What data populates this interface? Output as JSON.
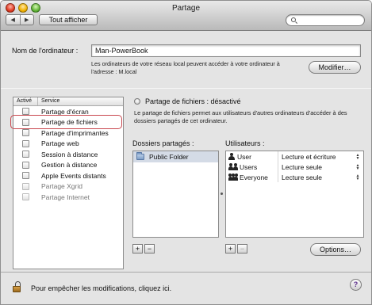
{
  "window": {
    "title": "Partage"
  },
  "toolbar": {
    "back": "◀",
    "forward": "▶",
    "show_all": "Tout afficher",
    "search_value": ""
  },
  "computer": {
    "label": "Nom de l'ordinateur :",
    "value": "Man-PowerBook",
    "note": "Les ordinateurs de votre réseau local peuvent accéder à votre ordinateur à l'adresse : M.local",
    "modify_button": "Modifier…"
  },
  "services": {
    "header_on": "Activé",
    "header_service": "Service",
    "items": [
      {
        "label": "Partage d'écran",
        "checked": false,
        "dim": false
      },
      {
        "label": "Partage de fichiers",
        "checked": false,
        "dim": false
      },
      {
        "label": "Partage d'imprimantes",
        "checked": false,
        "dim": false
      },
      {
        "label": "Partage web",
        "checked": false,
        "dim": false
      },
      {
        "label": "Session à distance",
        "checked": false,
        "dim": false
      },
      {
        "label": "Gestion à distance",
        "checked": false,
        "dim": false
      },
      {
        "label": "Apple Events distants",
        "checked": false,
        "dim": false
      },
      {
        "label": "Partage Xgrid",
        "checked": false,
        "dim": true
      },
      {
        "label": "Partage Internet",
        "checked": false,
        "dim": true
      }
    ]
  },
  "status": {
    "title": "Partage de fichiers : désactivé",
    "description": "Le partage de fichiers permet aux utilisateurs d'autres ordinateurs d'accéder à des dossiers partagés de cet ordinateur."
  },
  "folders": {
    "label": "Dossiers partagés :",
    "items": [
      "Public Folder"
    ]
  },
  "users": {
    "label": "Utilisateurs :",
    "items": [
      {
        "name": "User",
        "icon": "single-user-icon",
        "permission": "Lecture et écriture"
      },
      {
        "name": "Users",
        "icon": "group-icon",
        "permission": "Lecture seule"
      },
      {
        "name": "Everyone",
        "icon": "everyone-icon",
        "permission": "Lecture seule"
      }
    ],
    "stepper": "▲▼"
  },
  "controls": {
    "add": "+",
    "remove": "−",
    "options_button": "Options…"
  },
  "footer": {
    "lock_text": "Pour empêcher les modifications, cliquez ici.",
    "help": "?"
  }
}
